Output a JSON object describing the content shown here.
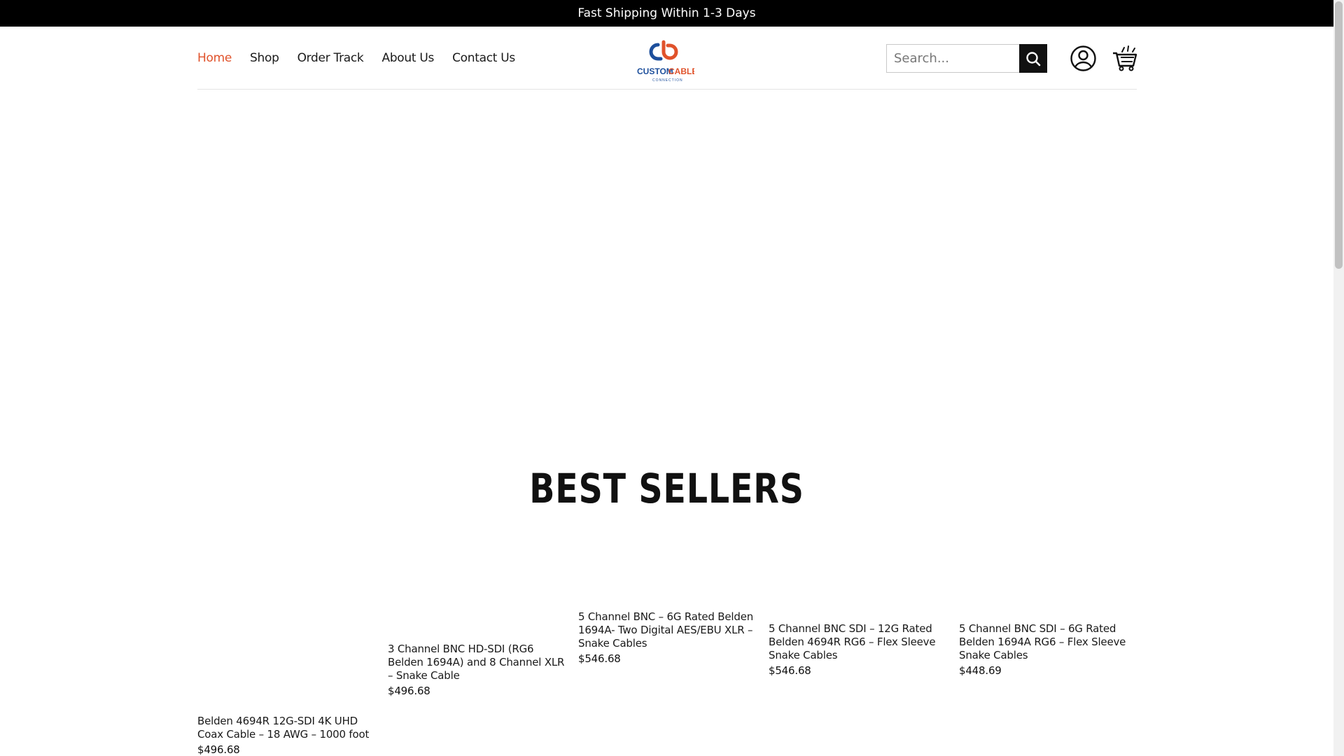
{
  "announcement": "Fast Shipping Within 1-3 Days",
  "nav": {
    "items": [
      {
        "label": "Home",
        "active": true
      },
      {
        "label": "Shop",
        "active": false
      },
      {
        "label": "Order Track",
        "active": false
      },
      {
        "label": "About Us",
        "active": false
      },
      {
        "label": "Contact Us",
        "active": false
      }
    ]
  },
  "logo": {
    "text_primary": "CUSTOM",
    "text_secondary": "CABLE",
    "tagline": "CONNECTION",
    "colors": {
      "blue": "#1d4f9c",
      "orange": "#e0522b"
    }
  },
  "search": {
    "placeholder": "Search...",
    "value": ""
  },
  "icons": {
    "search": "search-icon",
    "account": "user-icon",
    "cart": "cart-icon"
  },
  "best_sellers": {
    "title": "BEST SELLERS",
    "products": [
      {
        "name": "Belden 4694R 12G-SDI 4K UHD Coax Cable – 18 AWG – 1000 foot",
        "price": "$496.68"
      },
      {
        "name": "3 Channel BNC HD-SDI (RG6 Belden 1694A) and 8 Channel XLR – Snake Cable",
        "price": "$496.68"
      },
      {
        "name": "5 Channel BNC – 6G Rated Belden 1694A- Two Digital AES/EBU XLR – Snake Cables",
        "price": "$546.68"
      },
      {
        "name": "5 Channel BNC SDI – 12G Rated Belden 4694R RG6 – Flex Sleeve Snake Cables",
        "price": "$546.68"
      },
      {
        "name": "5 Channel BNC SDI – 6G Rated Belden 1694A RG6 – Flex Sleeve Snake Cables",
        "price": "$448.69"
      }
    ]
  },
  "colors": {
    "accent": "#e0522b",
    "topbar": "#000000"
  }
}
